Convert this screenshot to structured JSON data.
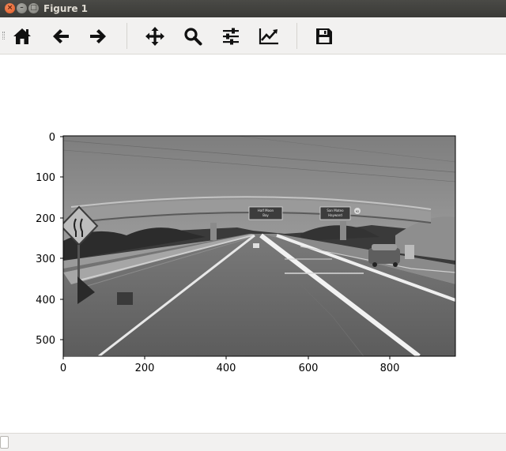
{
  "window": {
    "title": "Figure 1",
    "close_glyph": "×",
    "min_glyph": "–",
    "max_glyph": "□"
  },
  "toolbar": {
    "buttons": [
      {
        "name": "home",
        "icon": "home-icon"
      },
      {
        "name": "back",
        "icon": "arrow-left-icon"
      },
      {
        "name": "forward",
        "icon": "arrow-right-icon"
      },
      {
        "name": "pan",
        "icon": "move-icon"
      },
      {
        "name": "zoom",
        "icon": "zoom-icon"
      },
      {
        "name": "subplots",
        "icon": "sliders-icon"
      },
      {
        "name": "axes",
        "icon": "chart-line-icon"
      },
      {
        "name": "save",
        "icon": "save-icon"
      }
    ]
  },
  "plot": {
    "xticks": [
      "0",
      "200",
      "400",
      "600",
      "800"
    ],
    "yticks": [
      "0",
      "100",
      "200",
      "300",
      "400",
      "500"
    ],
    "image": "grayscale road scene with overpass bridge",
    "signs": {
      "left_panel": [
        "Half Moon",
        "Bay"
      ],
      "right_panel": [
        "San Mateo",
        "Hayward"
      ],
      "route_shield": "92"
    }
  },
  "colors": {
    "titlebar": "#3c3b37",
    "toolbar": "#f2f1f0",
    "close": "#e2592c"
  }
}
